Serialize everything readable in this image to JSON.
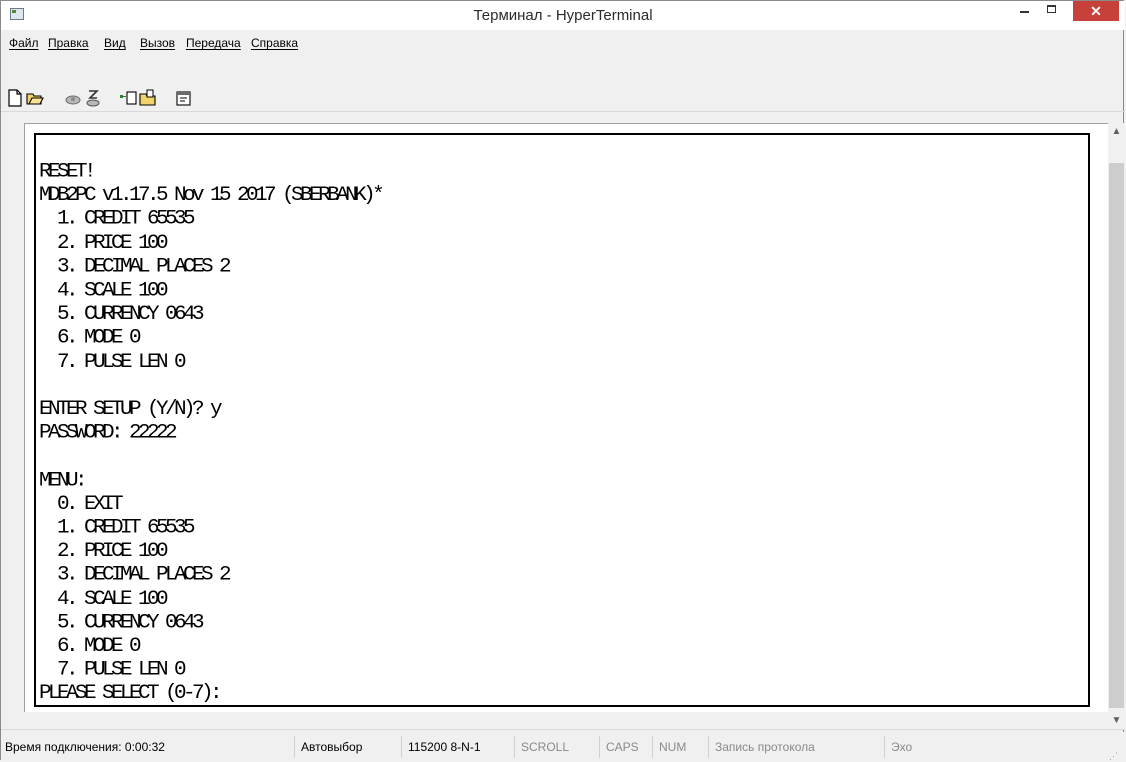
{
  "window": {
    "title": "Терминал - HyperTerminal",
    "accent_close": "#c7403a"
  },
  "menu": {
    "items": [
      {
        "label": "Файл"
      },
      {
        "label": "Правка"
      },
      {
        "label": "Вид"
      },
      {
        "label": "Вызов"
      },
      {
        "label": "Передача"
      },
      {
        "label": "Справка"
      }
    ]
  },
  "toolbar": {
    "icons": [
      "new-document-icon",
      "open-folder-icon",
      "call-icon",
      "disconnect-icon",
      "send-icon",
      "receive-icon",
      "properties-icon"
    ]
  },
  "terminal": {
    "lines": [
      "RESET!",
      "MDB2PC v1.17.5 Nov 15 2017 (SBERBANK)*",
      "  1. CREDIT 65535",
      "  2. PRICE 100",
      "  3. DECIMAL PLACES 2",
      "  4. SCALE 100",
      "  5. CURRENCY 0643",
      "  6. MODE 0",
      "  7. PULSE LEN 0",
      "",
      "ENTER SETUP (Y/N)? y",
      "PASSWORD: 22222",
      "",
      "MENU:",
      "  0. EXIT",
      "  1. CREDIT 65535",
      "  2. PRICE 100",
      "  3. DECIMAL PLACES 2",
      "  4. SCALE 100",
      "  5. CURRENCY 0643",
      "  6. MODE 0",
      "  7. PULSE LEN 0",
      "PLEASE SELECT (0-7):"
    ]
  },
  "statusbar": {
    "connection_time": "Время подключения: 0:00:32",
    "detect": "Автовыбор",
    "port_settings": "115200 8-N-1",
    "scroll": "SCROLL",
    "caps": "CAPS",
    "num": "NUM",
    "capture": "Запись протокола",
    "echo": "Эхо"
  }
}
